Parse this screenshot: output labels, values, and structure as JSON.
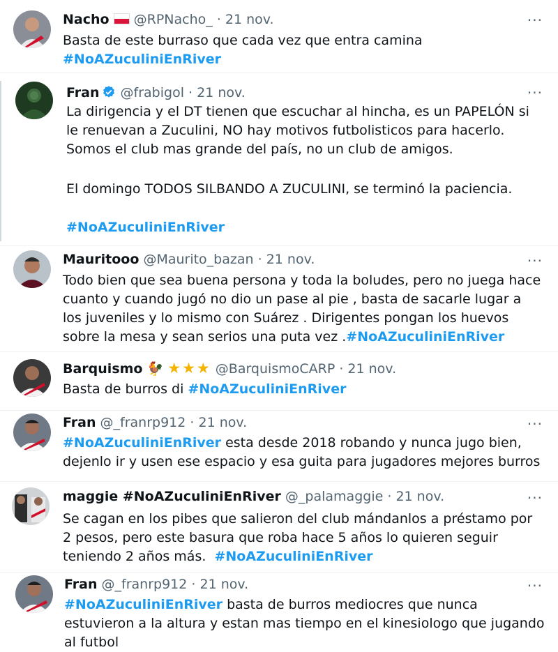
{
  "more_glyph": "···",
  "dot": "·",
  "tweets": [
    {
      "name": "Nacho",
      "handle": "@RPNacho_",
      "date": "21 nov.",
      "lines": [
        "Basta de este burraso que cada vez que entra camina"
      ],
      "hashtag": "#NoAZuculiniEnRiver"
    },
    {
      "name": "Fran",
      "handle": "@frabigol",
      "date": "21 nov.",
      "p1": "La dirigencia y el DT tienen que escuchar al hincha, es un PAPELÓN si le renuevan a Zuculini, NO hay motivos futbolisticos para hacerlo. Somos el club mas grande del país, no un club de amigos.",
      "p2": "El domingo TODOS SILBANDO A ZUCULINI, se terminó la paciencia.",
      "hashtag": "#NoAZuculiniEnRiver"
    },
    {
      "name": "Mauritooo",
      "handle": "@Maurito_bazan",
      "date": "21 nov.",
      "text": "Todo bien que sea buena persona y toda la boludes, pero no juega hace cuanto y cuando jugó no dio un pase al pie , basta de sacarle lugar a los juveniles y lo mismo con Suárez . Dirigentes pongan los huevos sobre la mesa y sean serios una puta vez .",
      "hashtag": "#NoAZuculiniEnRiver"
    },
    {
      "name": "Barquismo",
      "name_icon": "🐓",
      "stars": "★★★",
      "handle": "@BarquismoCARP",
      "date": "21 nov.",
      "text": "Basta de burros di ",
      "hashtag": "#NoAZuculiniEnRiver"
    },
    {
      "name": "Fran",
      "handle": "@_franrp912",
      "date": "21 nov.",
      "hashtag": "#NoAZuculiniEnRiver",
      "text": " esta desde 2018 robando y nunca jugo bien, dejenlo ir y usen ese espacio y esa guita para jugadores mejores burros"
    },
    {
      "name": "maggie #NoAZuculiniEnRiver",
      "handle": "@_palamaggie",
      "date": "21 nov.",
      "text": "Se cagan en los pibes que salieron del club mándanlos a préstamo por 2 pesos, pero este basura que roba hace 5 años lo quieren seguir teniendo 2 años más.  ",
      "hashtag": "#NoAZuculiniEnRiver"
    },
    {
      "name": "Fran",
      "handle": "@_franrp912",
      "date": "21 nov.",
      "hashtag": "#NoAZuculiniEnRiver",
      "text": " basta de burros mediocres que nunca estuvieron a la altura y estan mas tiempo en el kinesiologo que jugando al futbol"
    }
  ]
}
